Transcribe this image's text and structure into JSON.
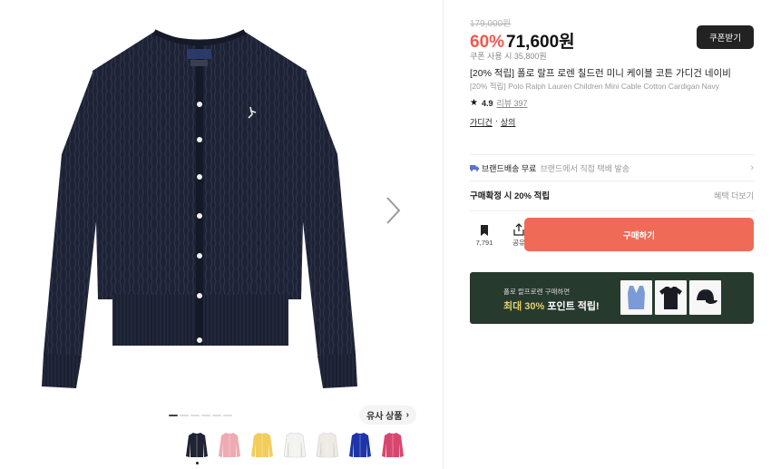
{
  "gallery": {
    "similar_label": "유사 상품",
    "thumbnails": [
      {
        "name": "navy",
        "color": "#1f2333"
      },
      {
        "name": "pink",
        "color": "#eeaab2"
      },
      {
        "name": "yellow",
        "color": "#f2cd5c"
      },
      {
        "name": "white",
        "color": "#f3f3f0"
      },
      {
        "name": "cream",
        "color": "#eeeae4"
      },
      {
        "name": "blue",
        "color": "#1d35a8"
      },
      {
        "name": "magenta",
        "color": "#d8466e"
      }
    ]
  },
  "product": {
    "original_price": "179,000원",
    "discount": "60%",
    "sale_price": "71,600원",
    "coupon_price": "쿠폰 사용 시 35,800원",
    "coupon_button": "쿠폰받기",
    "title_ko": "[20% 적립] 폴로 랄프 로렌 칠드런 미니 케이블 코튼 가디건 네이비",
    "title_en": "[20% 적립] Polo Ralph Lauren Children Mini Cable Cotton Cardigan Navy",
    "rating": "4.9",
    "review_label": "리뷰 397",
    "category_1": "가디건",
    "category_sep": "·",
    "category_2": "상의"
  },
  "shipping": {
    "main": "브랜드배송 무료",
    "sub": "브랜드에서 직접 택배 발송"
  },
  "points": {
    "label": "구매확정 시 20% 적립",
    "more": "혜택 더보기"
  },
  "actions": {
    "bookmark_count": "7,791",
    "share_label": "공유",
    "buy_label": "구매하기"
  },
  "banner": {
    "small_text": "폴로 랄프로렌 구매하면",
    "highlight": "최대 30%",
    "big_text_rest": " 포인트 적립!"
  },
  "colors": {
    "accent": "#ef6b57",
    "discount": "#f0594e",
    "banner_bg": "#273a2e"
  }
}
